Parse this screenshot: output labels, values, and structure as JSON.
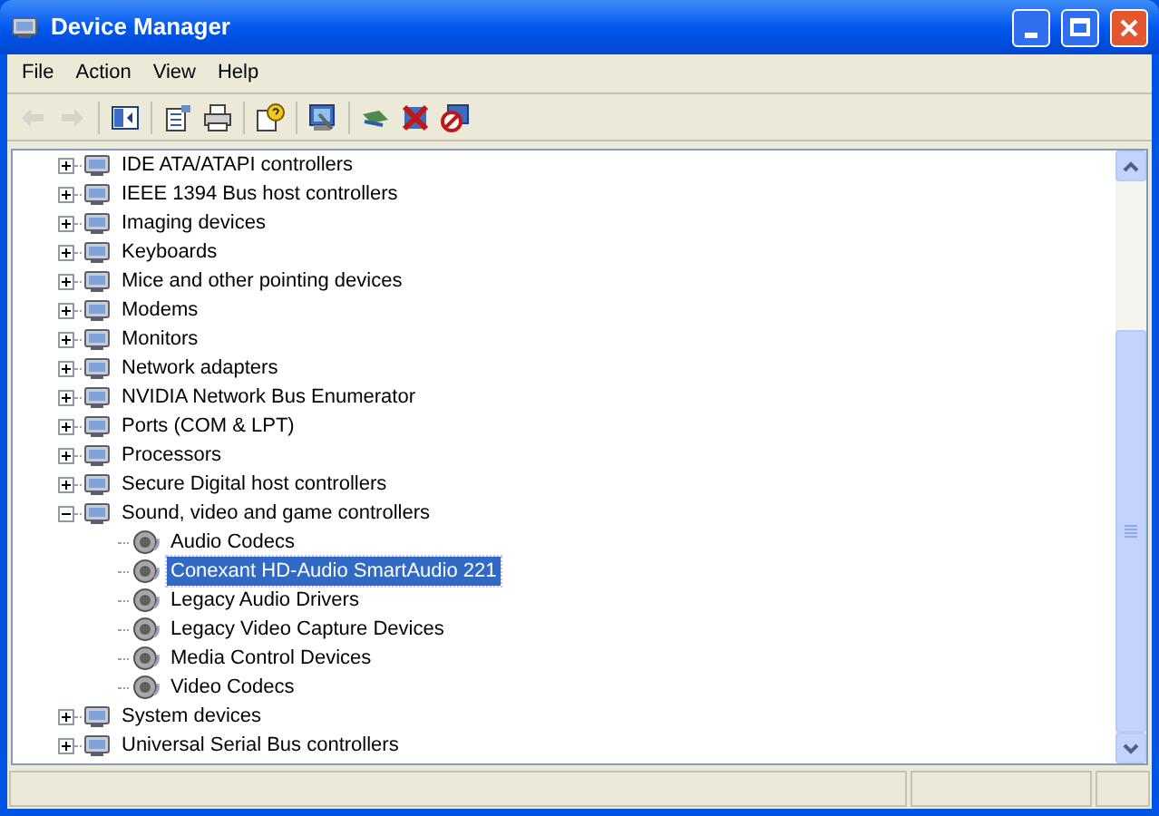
{
  "window": {
    "title": "Device Manager"
  },
  "menu": [
    "File",
    "Action",
    "View",
    "Help"
  ],
  "toolbar": [
    {
      "kind": "back",
      "disabled": true
    },
    {
      "kind": "forward",
      "disabled": true
    },
    {
      "kind": "sep"
    },
    {
      "kind": "panel",
      "disabled": false
    },
    {
      "kind": "sep"
    },
    {
      "kind": "properties",
      "disabled": false
    },
    {
      "kind": "print",
      "disabled": false
    },
    {
      "kind": "sep"
    },
    {
      "kind": "help",
      "disabled": false
    },
    {
      "kind": "sep"
    },
    {
      "kind": "scan",
      "disabled": false
    },
    {
      "kind": "sep"
    },
    {
      "kind": "update",
      "disabled": false
    },
    {
      "kind": "uninstall",
      "disabled": false
    },
    {
      "kind": "disable",
      "disabled": false
    }
  ],
  "tree": [
    {
      "label": "IDE ATA/ATAPI controllers",
      "expanded": false
    },
    {
      "label": "IEEE 1394 Bus host controllers",
      "expanded": false
    },
    {
      "label": "Imaging devices",
      "expanded": false
    },
    {
      "label": "Keyboards",
      "expanded": false
    },
    {
      "label": "Mice and other pointing devices",
      "expanded": false
    },
    {
      "label": "Modems",
      "expanded": false
    },
    {
      "label": "Monitors",
      "expanded": false
    },
    {
      "label": "Network adapters",
      "expanded": false
    },
    {
      "label": "NVIDIA Network Bus Enumerator",
      "expanded": false
    },
    {
      "label": "Ports (COM & LPT)",
      "expanded": false
    },
    {
      "label": "Processors",
      "expanded": false
    },
    {
      "label": "Secure Digital host controllers",
      "expanded": false
    },
    {
      "label": "Sound, video and game controllers",
      "expanded": true,
      "children": [
        {
          "label": "Audio Codecs",
          "selected": false
        },
        {
          "label": "Conexant HD-Audio SmartAudio 221",
          "selected": true
        },
        {
          "label": "Legacy Audio Drivers",
          "selected": false
        },
        {
          "label": "Legacy Video Capture Devices",
          "selected": false
        },
        {
          "label": "Media Control Devices",
          "selected": false
        },
        {
          "label": "Video Codecs",
          "selected": false
        }
      ]
    },
    {
      "label": "System devices",
      "expanded": false
    },
    {
      "label": "Universal Serial Bus controllers",
      "expanded": false
    }
  ]
}
